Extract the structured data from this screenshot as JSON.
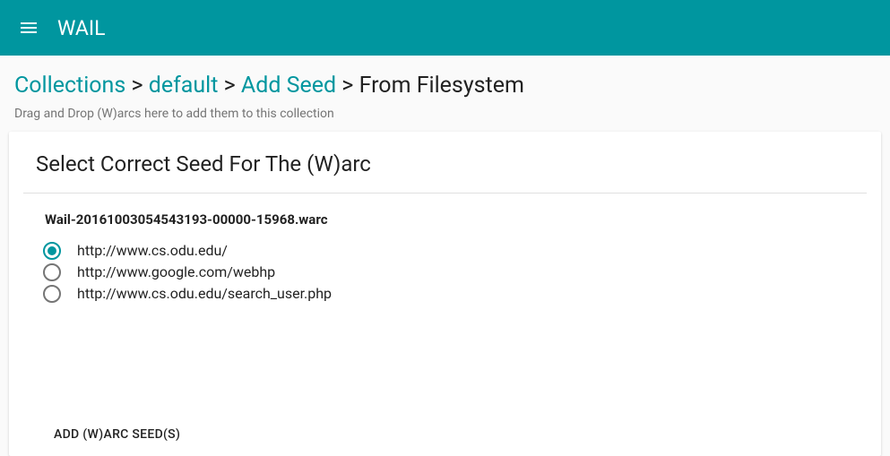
{
  "appbar": {
    "title": "WAIL"
  },
  "breadcrumb": {
    "items": [
      {
        "label": "Collections",
        "link": true
      },
      {
        "label": "default",
        "link": true
      },
      {
        "label": "Add Seed",
        "link": true
      },
      {
        "label": "From Filesystem",
        "link": false
      }
    ],
    "subtext": "Drag and Drop (W)arcs here to add them to this collection"
  },
  "card": {
    "title": "Select Correct Seed For The (W)arc",
    "file": "Wail-20161003054543193-00000-15968.warc",
    "options": [
      {
        "label": "http://www.cs.odu.edu/",
        "selected": true
      },
      {
        "label": "http://www.google.com/webhp",
        "selected": false
      },
      {
        "label": "http://www.cs.odu.edu/search_user.php",
        "selected": false
      }
    ],
    "action": "ADD (W)ARC SEED(S)"
  }
}
